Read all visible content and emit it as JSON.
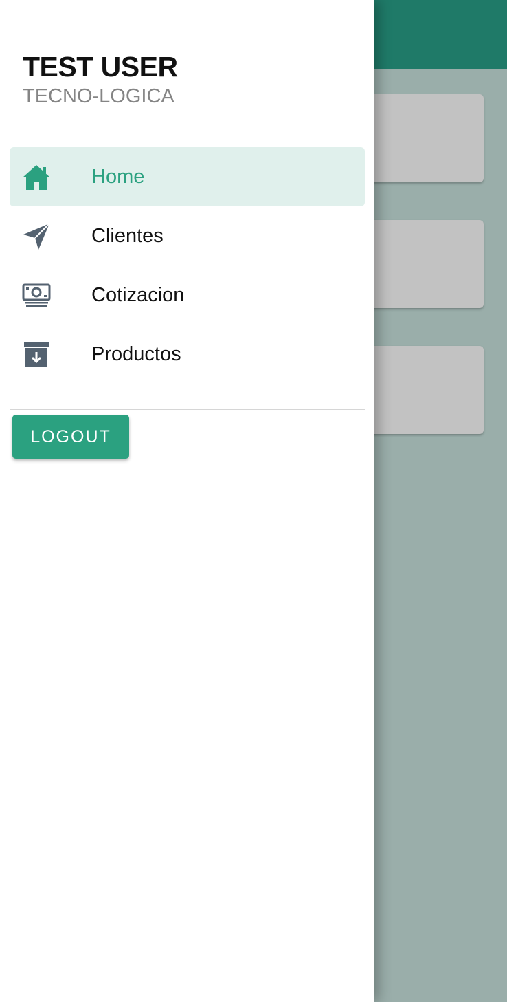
{
  "user": {
    "name": "TEST USER",
    "organization": "TECNO-LOGICA"
  },
  "nav": {
    "items": [
      {
        "label": "Home",
        "icon": "home-icon",
        "active": true
      },
      {
        "label": "Clientes",
        "icon": "send-icon",
        "active": false
      },
      {
        "label": "Cotizacion",
        "icon": "money-icon",
        "active": false
      },
      {
        "label": "Productos",
        "icon": "archive-icon",
        "active": false
      }
    ]
  },
  "logout": {
    "label": "LOGOUT"
  },
  "colors": {
    "accent": "#2ba180",
    "active_background": "#e0f0ec",
    "icon_gray": "#546270",
    "app_bar": "#1f7a68",
    "scrim": "#9aaeaa"
  }
}
